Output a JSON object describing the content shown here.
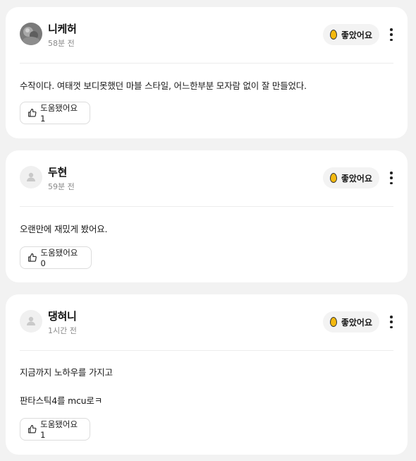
{
  "reviews": [
    {
      "author": "니케허",
      "time": "58분 전",
      "avatar": "photo",
      "rating_label": "좋았어요",
      "body": [
        "수작이다. 여태껏 보디못했던 마블 스타일, 어느한부분 모자람 없이 잘 만들었다."
      ],
      "helpful_label": "도움됐어요 1",
      "icons": {
        "rating": "egg-icon",
        "more": "more-vertical-icon",
        "helpful": "thumbs-up-icon"
      }
    },
    {
      "author": "두현",
      "time": "59분 전",
      "avatar": "default",
      "rating_label": "좋았어요",
      "body": [
        "오랜만에 재밌게 봤어요."
      ],
      "helpful_label": "도움됐어요 0",
      "icons": {
        "rating": "egg-icon",
        "more": "more-vertical-icon",
        "helpful": "thumbs-up-icon"
      }
    },
    {
      "author": "댕혀니",
      "time": "1시간 전",
      "avatar": "default",
      "rating_label": "좋았어요",
      "body": [
        "지금까지 노하우를 가지고",
        "판타스틱4를 mcu로ㅋ"
      ],
      "helpful_label": "도움됐어요 1",
      "icons": {
        "rating": "egg-icon",
        "more": "more-vertical-icon",
        "helpful": "thumbs-up-icon"
      }
    }
  ],
  "colors": {
    "egg": "#f5b90f",
    "background": "#f2f2f2",
    "card": "#ffffff"
  }
}
